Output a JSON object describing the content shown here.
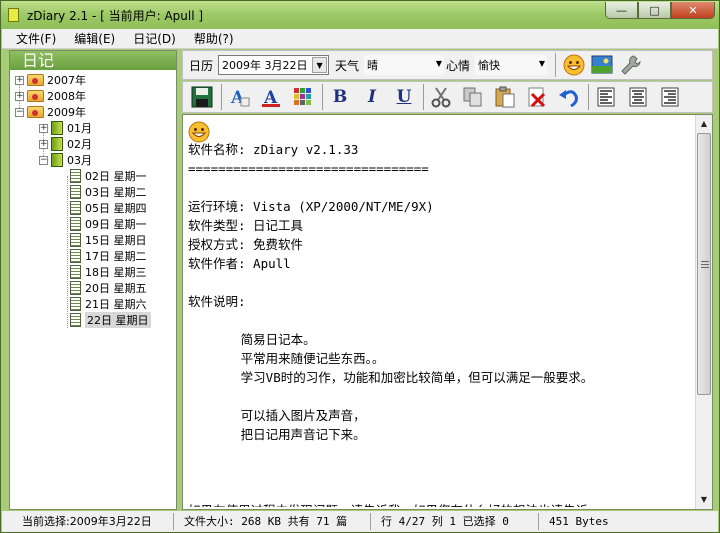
{
  "window": {
    "title": "zDiary 2.1  - [ 当前用户: Apull ]",
    "min_glyph": "—",
    "max_glyph": "□",
    "close_glyph": "✕"
  },
  "menu": [
    {
      "label": "文件(F)"
    },
    {
      "label": "编辑(E)"
    },
    {
      "label": "日记(D)"
    },
    {
      "label": "帮助(?)"
    }
  ],
  "left_panel": {
    "header": "日记",
    "years": [
      {
        "label": "2007年",
        "expanded": false
      },
      {
        "label": "2008年",
        "expanded": false
      },
      {
        "label": "2009年",
        "expanded": true
      }
    ],
    "months": [
      {
        "label": "01月",
        "expanded": false
      },
      {
        "label": "02月",
        "expanded": false
      },
      {
        "label": "03月",
        "expanded": true
      }
    ],
    "days": [
      "02日  星期一",
      "03日  星期二",
      "05日  星期四",
      "09日  星期一",
      "15日  星期日",
      "17日  星期二",
      "18日  星期三",
      "20日  星期五",
      "21日  星期六",
      "22日  星期日"
    ],
    "selected_day_index": 9
  },
  "toolbar1": {
    "date_label": "日历",
    "date_value": "2009年 3月22日",
    "weather_label": "天气",
    "weather_value": "晴",
    "mood_label": "心情",
    "mood_value": "愉快"
  },
  "toolbar2": {
    "bold": "B",
    "italic": "I",
    "underline": "U"
  },
  "editor": {
    "lines": [
      "",
      "软件名称: zDiary v2.1.33",
      "================================",
      "",
      "运行环境: Vista (XP/2000/NT/ME/9X)",
      "软件类型: 日记工具",
      "授权方式: 免费软件",
      "软件作者: Apull",
      "",
      "软件说明:",
      "",
      "       简易日记本。",
      "       平常用来随便记些东西。。",
      "       学习VB时的习作，功能和加密比较简单，但可以满足一般要求。",
      "",
      "       可以插入图片及声音，",
      "       把日记用声音记下来。",
      "",
      "",
      "",
      "如果在使用过程中发现问题，请告诉我，如果您有什么好的想法也请告诉"
    ]
  },
  "statusbar": {
    "current": "当前选择:2009年3月22日",
    "file": "文件大小: 268 KB  共有 71 篇",
    "position": "行 4/27 列 1  已选择 0",
    "bytes": "451 Bytes"
  },
  "colors": {
    "titlebar": "#9cc866",
    "header_green": "#6aa040",
    "desktop": "#7ab83a"
  }
}
